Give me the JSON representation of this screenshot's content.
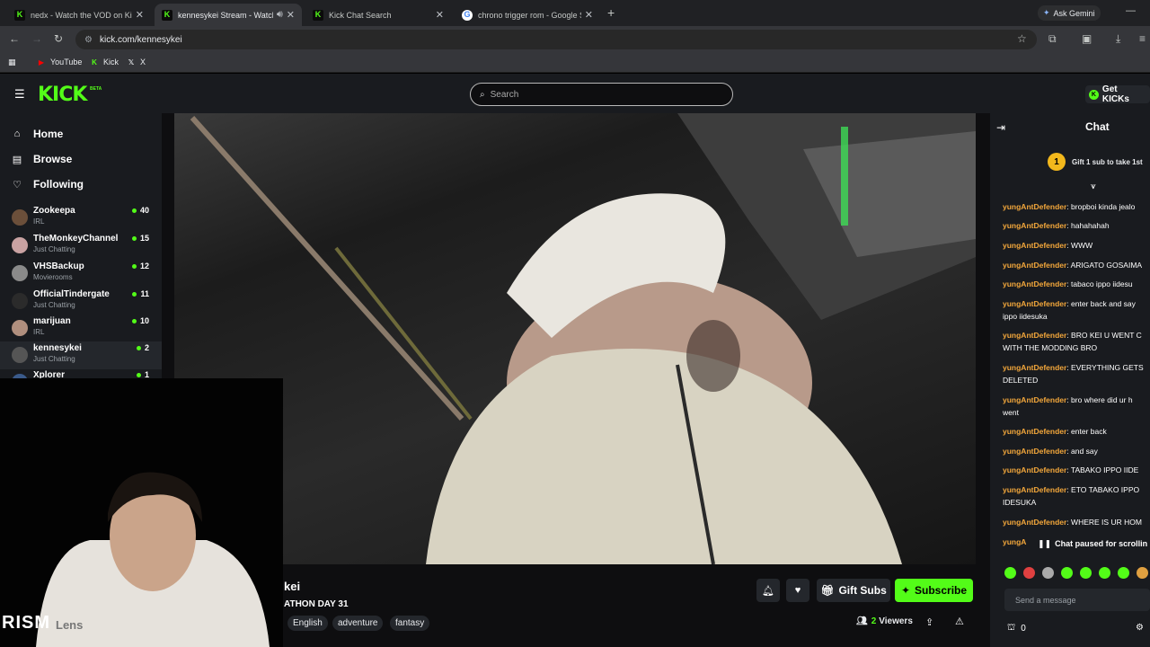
{
  "browser": {
    "tabs": [
      {
        "title": "nedx - Watch the VOD on Kick",
        "favicon": "kick-icon"
      },
      {
        "title": "kennesykei Stream - Watch",
        "favicon": "kick-icon",
        "active": true
      },
      {
        "title": "Kick Chat Search",
        "favicon": "kick-icon"
      },
      {
        "title": "chrono trigger rom - Google Se",
        "favicon": "google-icon"
      }
    ],
    "ask_gemini": "Ask Gemini",
    "url": "kick.com/kennesykei",
    "bookmarks": [
      {
        "label": "YouTube",
        "icon": "youtube-icon"
      },
      {
        "label": "Kick",
        "icon": "kick-icon"
      },
      {
        "label": "X",
        "icon": "x-icon"
      }
    ]
  },
  "header": {
    "logo": "KICK",
    "beta": "BETA",
    "search_placeholder": "Search",
    "get_kicks": "Get KICKs"
  },
  "sidebar": {
    "nav": [
      {
        "label": "Home",
        "icon": "home-icon"
      },
      {
        "label": "Browse",
        "icon": "browse-icon"
      },
      {
        "label": "Following",
        "icon": "heart-icon"
      }
    ],
    "channels": [
      {
        "name": "Zookeepa",
        "category": "IRL",
        "viewers": "40"
      },
      {
        "name": "TheMonkeyChannel",
        "category": "Just Chatting",
        "viewers": "15"
      },
      {
        "name": "VHSBackup",
        "category": "Movierooms",
        "viewers": "12"
      },
      {
        "name": "OfficialTindergate",
        "category": "Just Chatting",
        "viewers": "11"
      },
      {
        "name": "marijuan",
        "category": "IRL",
        "viewers": "10"
      },
      {
        "name": "kennesykei",
        "category": "Just Chatting",
        "viewers": "2",
        "selected": true
      },
      {
        "name": "Xplorer",
        "category": "",
        "viewers": "1"
      }
    ]
  },
  "stream": {
    "title": "kei",
    "subtitle": "ATHON DAY 31",
    "tags": [
      "English",
      "adventure",
      "fantasy"
    ],
    "gift_subs": "Gift Subs",
    "subscribe": "Subscribe",
    "viewers_count": "2",
    "viewers_label": "Viewers",
    "overlay_text": "RISM",
    "overlay_text_faded": "Lens"
  },
  "chat": {
    "title": "Chat",
    "gift_badge": "1",
    "gift_text": "Gift 1 sub to take 1st",
    "messages": [
      {
        "user": "yungAntDefender",
        "text": "bropboi kinda jealo"
      },
      {
        "user": "yungAntDefender",
        "text": "hahahahah"
      },
      {
        "user": "yungAntDefender",
        "text": "WWW"
      },
      {
        "user": "yungAntDefender",
        "text": "ARIGATO GOSAIMA"
      },
      {
        "user": "yungAntDefender",
        "text": "tabaco ippo iidesu"
      },
      {
        "user": "yungAntDefender",
        "text": "enter back and say",
        "cont": "ippo iidesuka"
      },
      {
        "user": "yungAntDefender",
        "text": "BRO KEI U WENT C",
        "cont": "WITH THE MODDING BRO"
      },
      {
        "user": "yungAntDefender",
        "text": "EVERYTHING GETS",
        "cont": "DELETED"
      },
      {
        "user": "yungAntDefender",
        "text": "bro where did ur h",
        "cont": "went"
      },
      {
        "user": "yungAntDefender",
        "text": "enter back"
      },
      {
        "user": "yungAntDefender",
        "text": "and say"
      },
      {
        "user": "yungAntDefender",
        "text": "TABAKO IPPO IIDE"
      },
      {
        "user": "yungAntDefender",
        "text": "ETO TABAKO IPPO",
        "cont": "IDESUKA"
      },
      {
        "user": "yungAntDefender",
        "text": "WHERE IS UR HOM"
      },
      {
        "user": "yungA",
        "text": ""
      }
    ],
    "paused": "Chat paused for scrollin",
    "send_placeholder": "Send a message",
    "points": "0"
  }
}
